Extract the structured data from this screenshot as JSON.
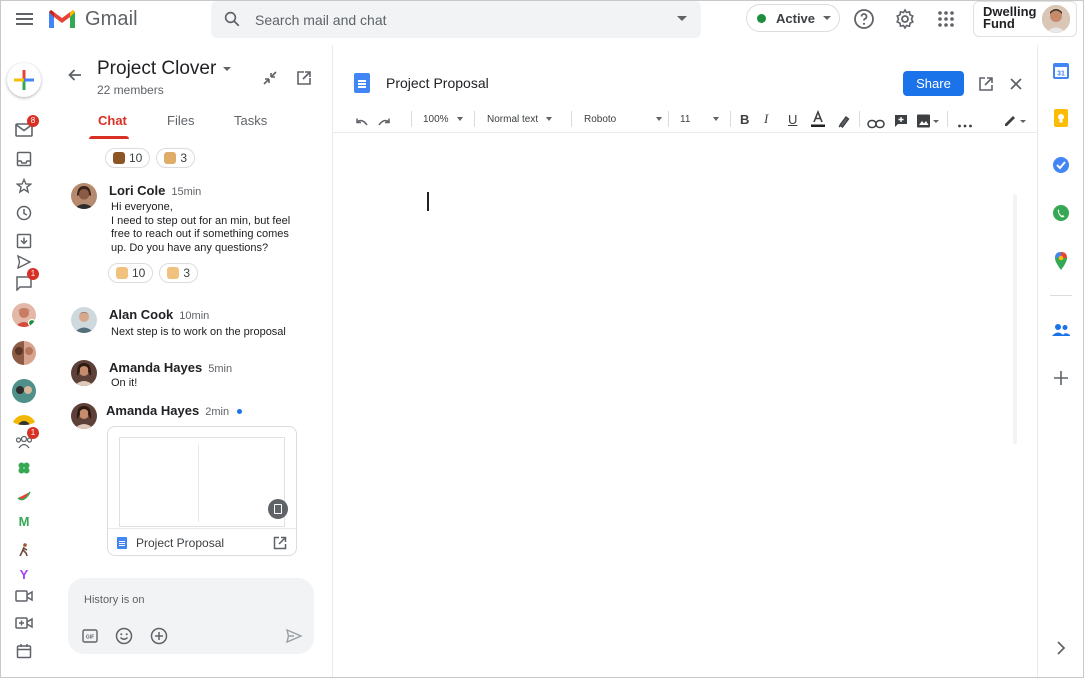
{
  "app": {
    "name": "Gmail"
  },
  "search": {
    "placeholder": "Search mail and chat"
  },
  "status": {
    "label": "Active",
    "color": "#1e8e3e"
  },
  "brand": {
    "line1": "Dwelling",
    "line2": "Fund"
  },
  "rail": {
    "badges": {
      "mail": "8",
      "chat": "1",
      "spaces": "1"
    },
    "letters": [
      "M",
      "Y"
    ]
  },
  "room": {
    "title": "Project Clover",
    "members": "22 members"
  },
  "tabs": [
    {
      "label": "Chat",
      "active": true
    },
    {
      "label": "Files",
      "active": false
    },
    {
      "label": "Tasks",
      "active": false
    }
  ],
  "reactions_top": [
    {
      "emoji": "thumbs-up-dark",
      "count": "10"
    },
    {
      "emoji": "clap",
      "count": "3"
    }
  ],
  "messages": [
    {
      "name": "Lori Cole",
      "time": "15min",
      "lines": [
        "Hi everyone,",
        "I need to step out for an min, but feel",
        "free to reach out if something comes",
        "up.  Do you have any questions?"
      ]
    },
    {
      "name": "Alan Cook",
      "time": "10min",
      "lines": [
        "Next step is to work on the proposal"
      ]
    },
    {
      "name": "Amanda Hayes",
      "time": "5min",
      "lines": [
        "On it!"
      ]
    },
    {
      "name": "Amanda Hayes",
      "time": "2min",
      "lines": []
    }
  ],
  "reactions_lori": [
    {
      "emoji": "thumbs-up-light",
      "count": "10"
    },
    {
      "emoji": "clap",
      "count": "3"
    }
  ],
  "attachment": {
    "name": "Project Proposal"
  },
  "composer": {
    "placeholder": "History is on"
  },
  "doc": {
    "title": "Project Proposal",
    "share_label": "Share",
    "zoom": "100%",
    "style": "Normal text",
    "font": "Roboto",
    "size": "11"
  },
  "colors": {
    "accent": "#d93025",
    "primary": "#1a73e8"
  }
}
